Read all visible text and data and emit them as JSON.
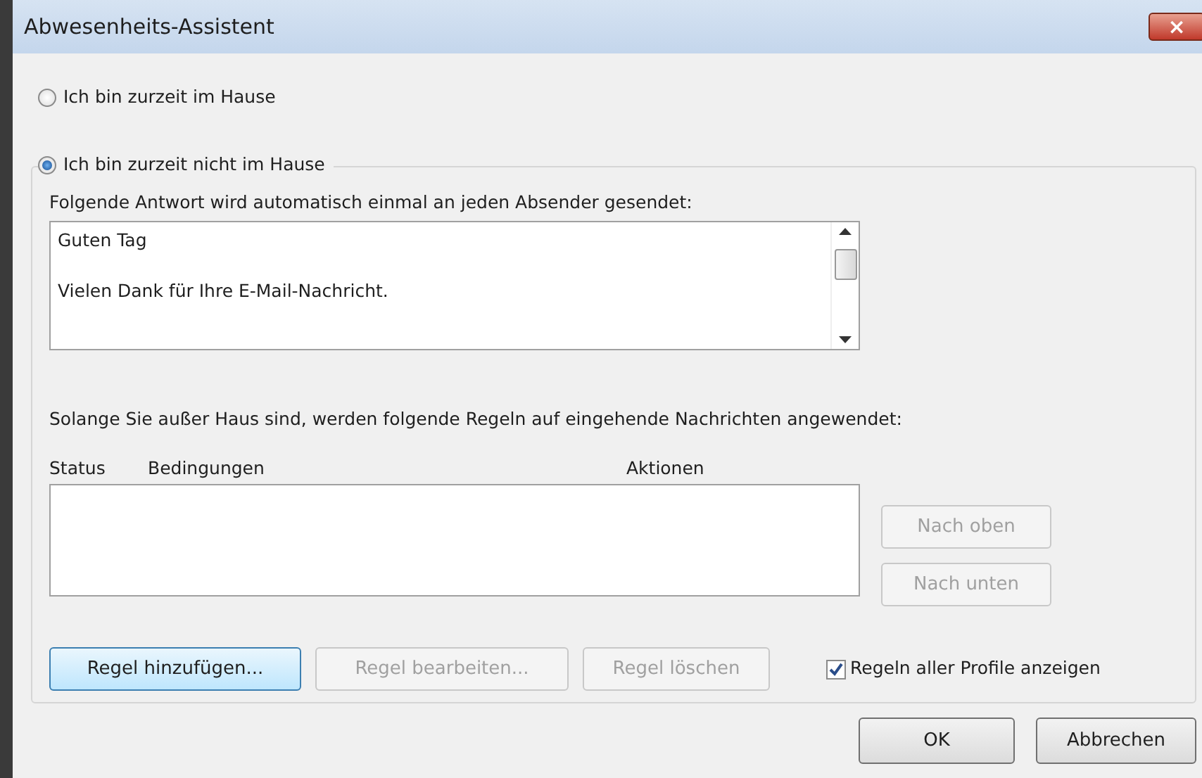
{
  "window": {
    "title": "Abwesenheits-Assistent",
    "close": "×"
  },
  "options": [
    {
      "label": "Ich bin zurzeit im Hause",
      "selected": false
    },
    {
      "label": "Ich bin zurzeit nicht im Hause",
      "selected": true
    }
  ],
  "reply": {
    "label": "Folgende Antwort wird automatisch einmal an jeden Absender gesendet:",
    "lines": [
      "Guten Tag",
      "Vielen Dank für Ihre E-Mail-Nachricht."
    ]
  },
  "rules": {
    "label": "Solange Sie außer Haus sind, werden folgende Regeln auf eingehende Nachrichten angewendet:",
    "columns": [
      "Status",
      "Bedingungen",
      "Aktionen"
    ],
    "side_buttons": [
      {
        "label": "Nach oben",
        "disabled": true
      },
      {
        "label": "Nach unten",
        "disabled": true
      }
    ],
    "buttons": [
      {
        "label": "Regel hinzufügen...",
        "disabled": false
      },
      {
        "label": "Regel bearbeiten...",
        "disabled": true
      },
      {
        "label": "Regel löschen",
        "disabled": true
      }
    ],
    "show_all": {
      "label": "Regeln aller Profile anzeigen",
      "checked": true
    }
  },
  "buttons": [
    "OK",
    "Abbrechen"
  ]
}
